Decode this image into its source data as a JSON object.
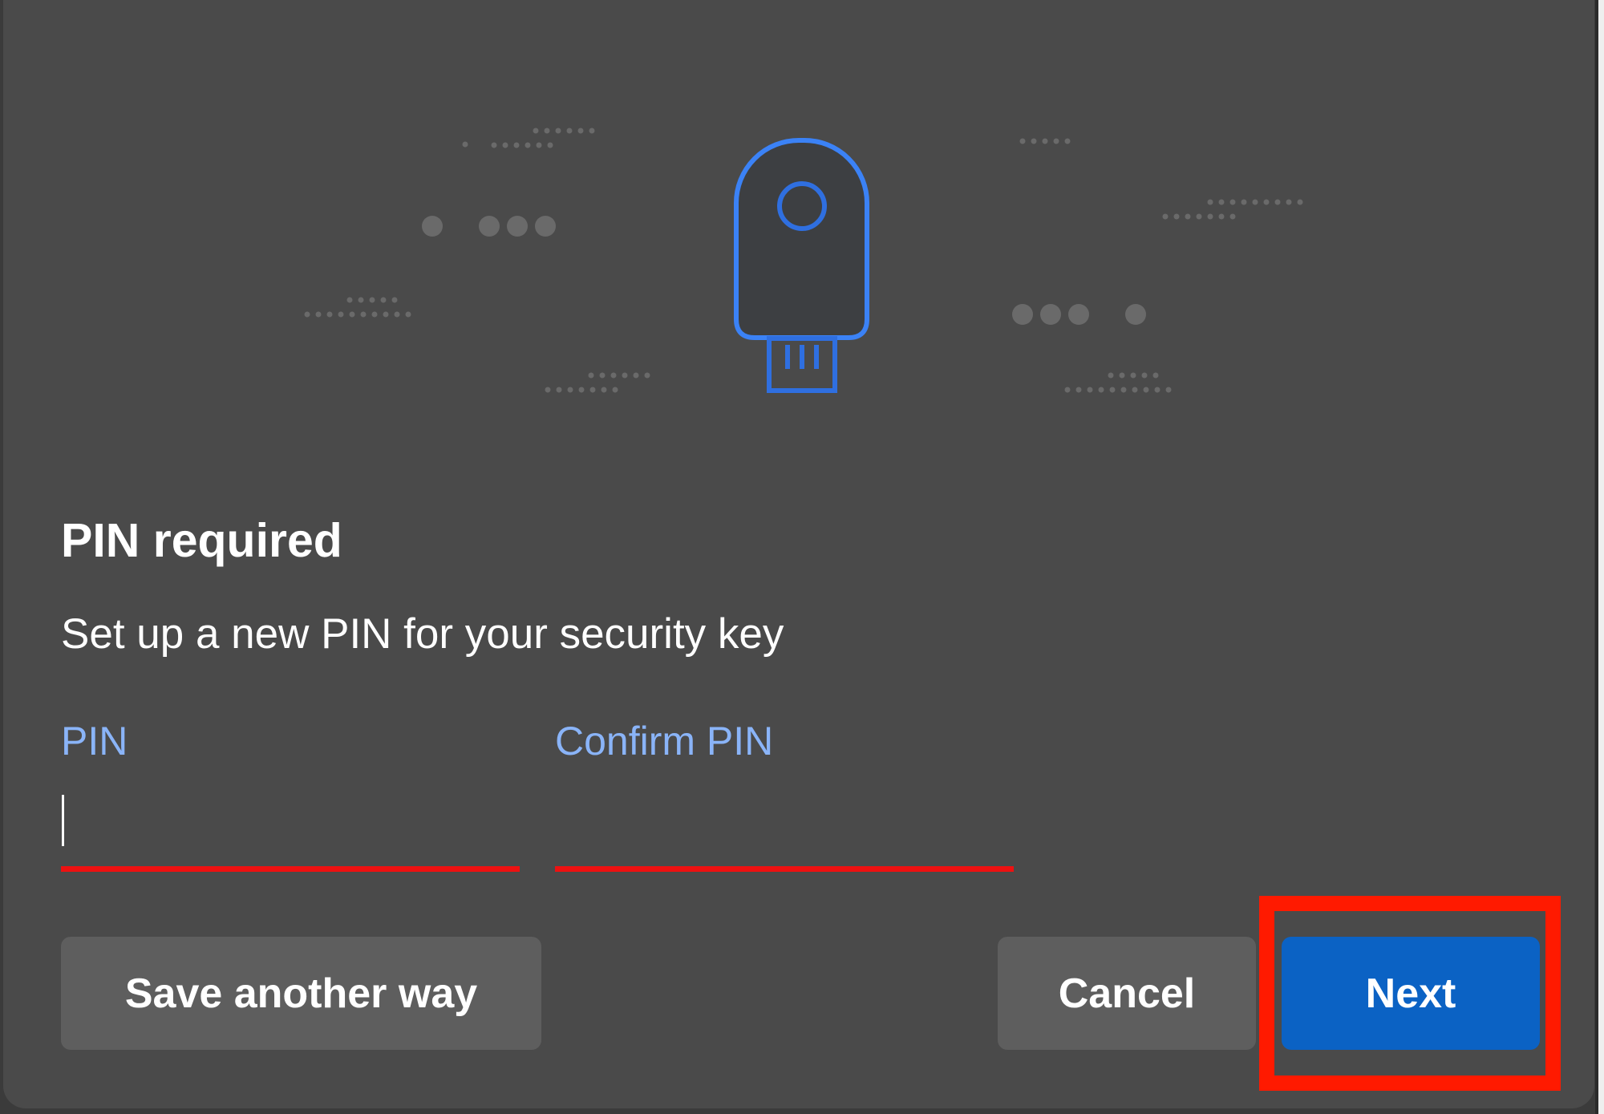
{
  "dialog": {
    "title": "PIN required",
    "subtitle": "Set up a new PIN for your security key"
  },
  "fields": {
    "pin": {
      "label": "PIN",
      "value": ""
    },
    "confirm_pin": {
      "label": "Confirm PIN",
      "value": ""
    }
  },
  "buttons": {
    "save_another_way": "Save another way",
    "cancel": "Cancel",
    "next": "Next"
  },
  "illustration": {
    "icon": "security-key-icon",
    "decoration": "dot-patterns"
  },
  "annotation": {
    "highlight_target": "next-button",
    "highlight_color": "#ff1a00"
  },
  "colors": {
    "dialog_background": "#4a4a4a",
    "field_label": "#8ab4f8",
    "field_error_underline": "#ee1111",
    "primary_button": "#0b62c4",
    "secondary_button": "#5e5e5e",
    "icon_accent": "#3b82f6"
  }
}
